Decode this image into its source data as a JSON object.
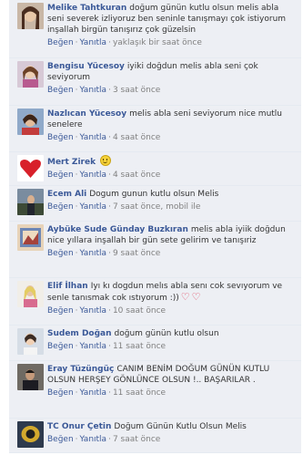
{
  "actions": {
    "like": "Beğen",
    "reply": "Yanıtla",
    "separator": "·"
  },
  "comments": [
    {
      "author": "Melike Tahtkuran",
      "text": "doğum günün kutlu olsun melis abla seni severek izliyoruz ben seninle tanışmayı çok istiyorum inşallah birgün tanışırız çok güzelsin",
      "time": "yaklaşık bir saat önce"
    },
    {
      "author": "Bengisu Yücesoy",
      "text": "iyiki doğdun melis abla seni çok seviyorum",
      "time": "3 saat önce"
    },
    {
      "author": "Nazlıcan Yücesoy",
      "text": "melis abla seni seviyorum nice mutlu senelere",
      "time": "4 saat önce"
    },
    {
      "author": "Mert Zirek",
      "text": "",
      "time": "4 saat önce"
    },
    {
      "author": "Ecem Ali",
      "text": "Dogum gunun kutlu olsun Melis",
      "time": "7 saat önce, mobil ile"
    },
    {
      "author": "Aybüke Sude Günday Buzkıran",
      "text": "melis abla iyiik doğdun nice yıllara inşallah bir gün sete gelirim ve tanışıriz",
      "time": "9 saat önce"
    },
    {
      "author": "Elif İlhan",
      "text": "Iyı kı dogdun melıs abla senı cok sevıyorum ve senle tanısmak cok ıstıyorum :))",
      "time": "10 saat önce"
    },
    {
      "author": "Sudem Doğan",
      "text": "doğum günün kutlu olsun",
      "time": "11 saat önce"
    },
    {
      "author": "Eray Tüzüngüç",
      "text": "CANIM BENİM DOĞUM GÜNÜN KUTLU OLSUN HERŞEY GÖNLÜNCE OLSUN !.. BAŞARILAR .",
      "time": "11 saat önce"
    },
    {
      "author": "TC Onur Çetin",
      "text": "Doğum Günün Kutlu Olsun Melis",
      "time": "7 saat önce"
    }
  ]
}
